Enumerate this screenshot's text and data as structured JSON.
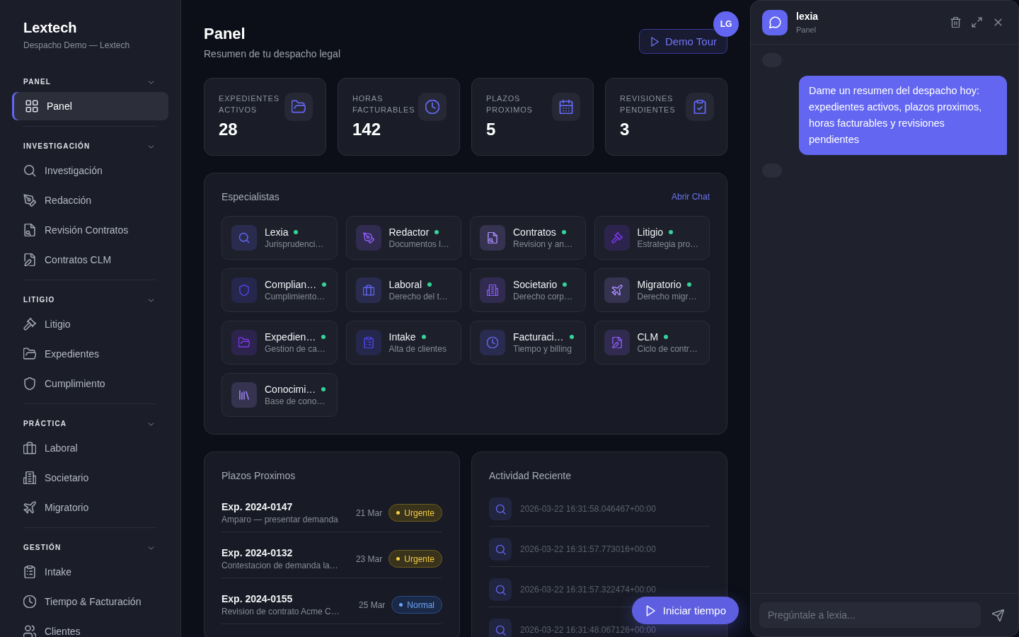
{
  "sidebar": {
    "brand": "Lextech",
    "subtitle": "Despacho Demo — Lextech",
    "sections": [
      {
        "title": "PANEL",
        "expanded": true,
        "items": [
          {
            "label": "Panel",
            "selected": true
          }
        ]
      },
      {
        "title": "INVESTIGACIÓN",
        "expanded": true,
        "items": [
          {
            "label": "Investigación",
            "selected": false
          },
          {
            "label": "Redacción",
            "selected": false
          },
          {
            "label": "Revisión Contratos",
            "selected": false
          },
          {
            "label": "Contratos CLM",
            "selected": false
          }
        ]
      },
      {
        "title": "LITIGIO",
        "expanded": true,
        "items": [
          {
            "label": "Litigio",
            "selected": false
          },
          {
            "label": "Expedientes",
            "selected": false
          },
          {
            "label": "Cumplimiento",
            "selected": false
          }
        ]
      },
      {
        "title": "PRÁCTICA",
        "expanded": true,
        "items": [
          {
            "label": "Laboral",
            "selected": false
          },
          {
            "label": "Societario",
            "selected": false
          },
          {
            "label": "Migratorio",
            "selected": false
          }
        ]
      },
      {
        "title": "GESTIÓN",
        "expanded": true,
        "items": [
          {
            "label": "Intake",
            "selected": false
          },
          {
            "label": "Tiempo & Facturación",
            "selected": false
          },
          {
            "label": "Clientes",
            "selected": false
          }
        ]
      }
    ]
  },
  "header": {
    "title": "Panel",
    "subtitle": "Resumen de tu despacho legal",
    "tour_button": "Demo Tour",
    "avatar": "LG"
  },
  "stats": [
    {
      "label": "EXPEDIENTES ACTIVOS",
      "value": "28"
    },
    {
      "label": "HORAS FACTURABLES",
      "value": "142"
    },
    {
      "label": "PLAZOS PROXIMOS",
      "value": "5"
    },
    {
      "label": "REVISIONES PENDIENTES",
      "value": "3"
    }
  ],
  "specialists": {
    "title": "Especialistas",
    "link": "Abrir Chat",
    "agents": [
      {
        "name": "Lexia",
        "description": "Jurisprudenci…",
        "online": true,
        "color": "#6366f1"
      },
      {
        "name": "Redactor",
        "description": "Documentos l…",
        "online": true,
        "color": "#8b5cf6"
      },
      {
        "name": "Contratos",
        "description": "Revision y an…",
        "online": true,
        "color": "#a78bfa"
      },
      {
        "name": "Litigio",
        "description": "Estrategia pro…",
        "online": true,
        "color": "#7c3aed"
      },
      {
        "name": "Complian…",
        "description": "Cumplimiento…",
        "online": true,
        "color": "#4f46e5"
      },
      {
        "name": "Laboral",
        "description": "Derecho del t…",
        "online": true,
        "color": "#6366f1"
      },
      {
        "name": "Societario",
        "description": "Derecho corp…",
        "online": true,
        "color": "#8b5cf6"
      },
      {
        "name": "Migratorio",
        "description": "Derecho migr…",
        "online": true,
        "color": "#a78bfa"
      },
      {
        "name": "Expedien…",
        "description": "Gestion de ca…",
        "online": true,
        "color": "#7c3aed"
      },
      {
        "name": "Intake",
        "description": "Alta de clientes",
        "online": true,
        "color": "#4f46e5"
      },
      {
        "name": "Facturaci…",
        "description": "Tiempo y billing",
        "online": true,
        "color": "#6366f1"
      },
      {
        "name": "CLM",
        "description": "Ciclo de contr…",
        "online": true,
        "color": "#8b5cf6"
      },
      {
        "name": "Conocimi…",
        "description": "Base de cono…",
        "online": true,
        "color": "#a78bfa"
      }
    ]
  },
  "deadlines": {
    "title": "Plazos Proximos",
    "items": [
      {
        "case": "Exp. 2024-0147",
        "description": "Amparo — presentar demanda",
        "date": "21 Mar",
        "badge": "Urgente",
        "kind": "urgent"
      },
      {
        "case": "Exp. 2024-0132",
        "description": "Contestacion de demanda la…",
        "date": "23 Mar",
        "badge": "Urgente",
        "kind": "urgent"
      },
      {
        "case": "Exp. 2024-0155",
        "description": "Revision de contrato Acme C…",
        "date": "25 Mar",
        "badge": "Normal",
        "kind": "normal"
      }
    ]
  },
  "activity": {
    "title": "Actividad Reciente",
    "items": [
      {
        "timestamp": "2026-03-22 16:31:58.046467+00:00"
      },
      {
        "timestamp": "2026-03-22 16:31:57.773016+00:00"
      },
      {
        "timestamp": "2026-03-22 16:31:57.322474+00:00"
      },
      {
        "timestamp": "2026-03-22 16:31:48.067126+00:00"
      }
    ]
  },
  "timer_button": "Iniciar tiempo",
  "chat": {
    "title": "lexia",
    "subtitle": "Panel",
    "messages": [
      {
        "kind": "placeholder"
      },
      {
        "kind": "user",
        "text": "Dame un resumen del despacho hoy: expedientes activos, plazos proximos, horas facturables y revisiones pendientes"
      },
      {
        "kind": "placeholder"
      }
    ],
    "input": {
      "placeholder": "Pregúntale a lexia..."
    }
  }
}
